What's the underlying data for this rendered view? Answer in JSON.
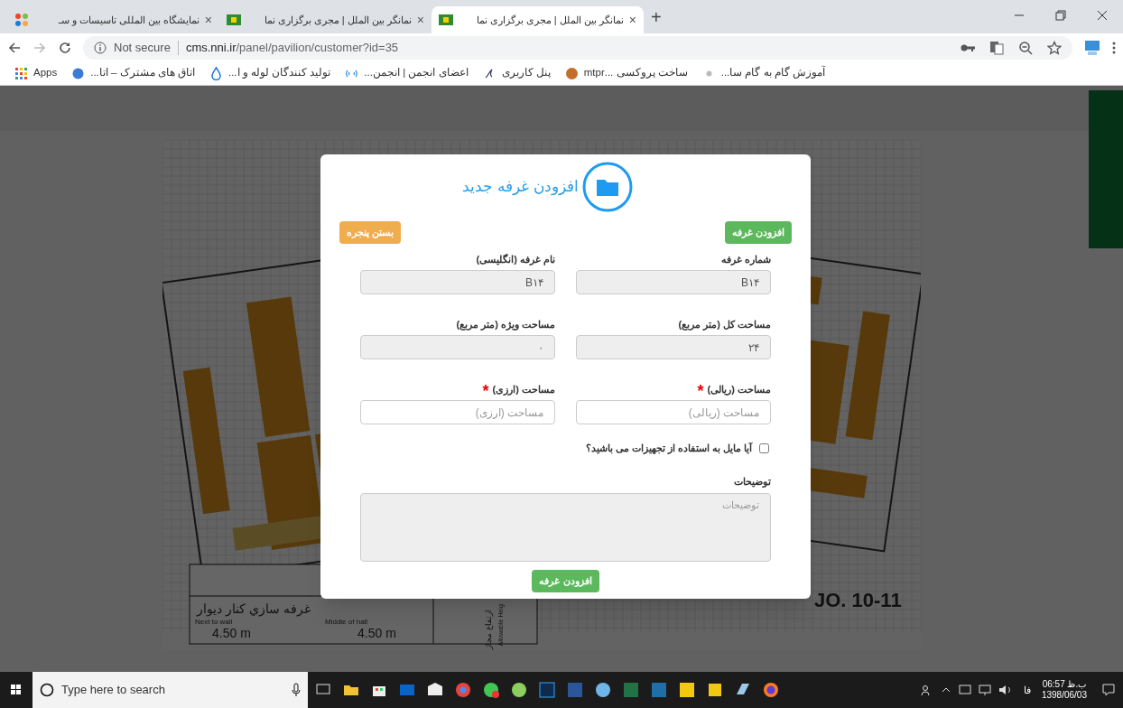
{
  "browser": {
    "tabs": [
      {
        "title": "نمانگر بین الملل | مجری برگزاری نما",
        "close": "×",
        "selected": true
      },
      {
        "title": "نمانگر بین الملل | مجری برگزاری نما",
        "close": "×",
        "selected": false
      },
      {
        "title": "نمایشگاه بین المللی تاسیسات و سـ",
        "close": "×",
        "selected": false
      }
    ],
    "new_tab": "+",
    "security": "Not secure",
    "url_host": "cms.nni.ir",
    "url_path": "/panel/pavilion/customer?id=35",
    "bookmarks": [
      "آموزش گام به گام سا...",
      "ساخت پروکسی ...mtpr",
      "پنل کاربری",
      "اعضای انجمن | انجمن...",
      "تولید کنندگان لوله و ا...",
      "اتاق های مشترک – اتا...",
      "Apps"
    ]
  },
  "plan": {
    "legend_title": "غرفه سازي کنار ديوار",
    "next_to_wall": "Next to wall",
    "size_1": "4.50 m",
    "middle_of_hall": "Middle of hall",
    "size_2": "4.50 m",
    "height_fa": "ارتفاع مجاز",
    "height_en": "Allowable Heig",
    "hall": "JO. 10-11"
  },
  "modal": {
    "title": "افزودن غرفه جدید",
    "add_button": "افزودن غرفه",
    "close_button": "بستن پنجره",
    "fields": [
      {
        "label": "شماره غرفه",
        "value": "B۱۴",
        "disabled": true
      },
      {
        "label": "نام غرفه (انگلیسی)",
        "value": "B۱۴",
        "disabled": true
      },
      {
        "label": "مساحت کل (متر مربع)",
        "value": "۲۴",
        "disabled": true
      },
      {
        "label": "مساحت ویژه (متر مربع)",
        "value": "۰",
        "disabled": true
      },
      {
        "label": "مساحت (ریالی)",
        "required_mark": "*",
        "placeholder": "مساحت (ریالی)",
        "disabled": false
      },
      {
        "label": "مساحت (ارزی)",
        "required_mark": "*",
        "placeholder": "مساحت (ارزی)",
        "disabled": false
      }
    ],
    "equipment": {
      "label": "آیا مایل به استفاده از تجهیزات می باشید؟",
      "checked": false
    },
    "notes": {
      "label": "توضیحات",
      "placeholder": "توضیحات",
      "disabled": true
    },
    "submit": "افزودن غرفه"
  },
  "taskbar": {
    "search_placeholder": "Type here to search",
    "language": "فا",
    "time": "06:57 ب.ظ",
    "date": "1398/06/03"
  }
}
